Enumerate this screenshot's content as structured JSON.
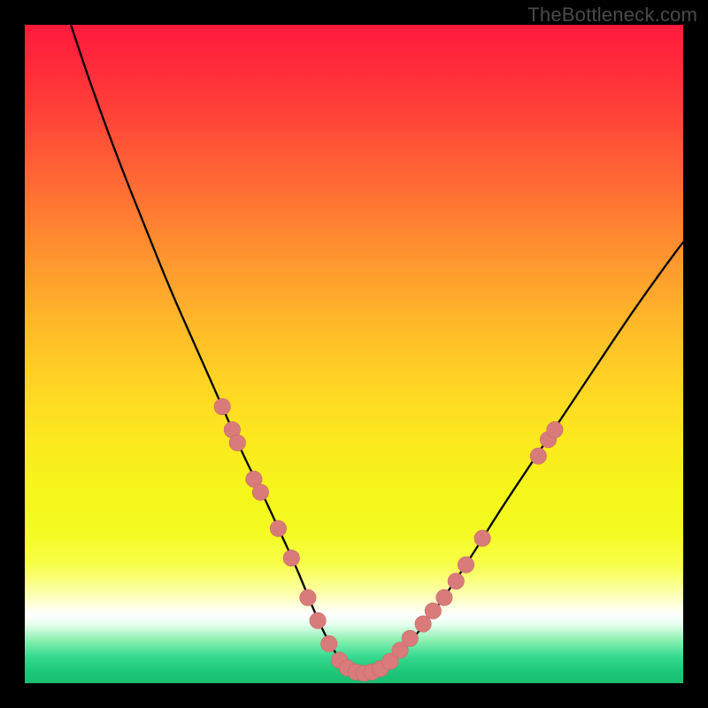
{
  "watermark": "TheBottleneck.com",
  "colors": {
    "background": "#000000",
    "curve": "#000000",
    "dot_fill": "#d97b7b",
    "dot_stroke": "#c96868"
  },
  "chart_data": {
    "type": "line",
    "title": "",
    "xlabel": "",
    "ylabel": "",
    "xlim": [
      0,
      100
    ],
    "ylim": [
      0,
      100
    ],
    "series": [
      {
        "name": "curve",
        "x": [
          7,
          10,
          14,
          18,
          22,
          26,
          30,
          33,
          36,
          39,
          41.5,
          43.5,
          45.5,
          47.5,
          49.5,
          51.5,
          54,
          57,
          60,
          64,
          68,
          72,
          77,
          82,
          87,
          92,
          97,
          100
        ],
        "y": [
          100,
          91,
          80,
          70,
          60,
          51,
          42,
          35,
          29,
          22.5,
          17,
          12,
          7.5,
          4,
          2,
          1.5,
          2,
          4.5,
          8,
          13.5,
          19.5,
          26,
          33.5,
          41,
          48.5,
          56,
          63,
          67
        ]
      }
    ],
    "markers": [
      {
        "x": 30.0,
        "y": 42.0
      },
      {
        "x": 31.5,
        "y": 38.5
      },
      {
        "x": 32.3,
        "y": 36.5
      },
      {
        "x": 34.8,
        "y": 31.0
      },
      {
        "x": 35.8,
        "y": 29.0
      },
      {
        "x": 38.5,
        "y": 23.5
      },
      {
        "x": 40.5,
        "y": 19.0
      },
      {
        "x": 43.0,
        "y": 13.0
      },
      {
        "x": 44.5,
        "y": 9.5
      },
      {
        "x": 46.2,
        "y": 6.0
      },
      {
        "x": 47.8,
        "y": 3.5
      },
      {
        "x": 49.0,
        "y": 2.3
      },
      {
        "x": 50.3,
        "y": 1.7
      },
      {
        "x": 51.5,
        "y": 1.5
      },
      {
        "x": 52.7,
        "y": 1.7
      },
      {
        "x": 54.0,
        "y": 2.2
      },
      {
        "x": 55.5,
        "y": 3.3
      },
      {
        "x": 57.0,
        "y": 5.0
      },
      {
        "x": 58.5,
        "y": 6.8
      },
      {
        "x": 60.5,
        "y": 9.0
      },
      {
        "x": 62.0,
        "y": 11.0
      },
      {
        "x": 63.7,
        "y": 13.0
      },
      {
        "x": 65.5,
        "y": 15.5
      },
      {
        "x": 67.0,
        "y": 18.0
      },
      {
        "x": 69.5,
        "y": 22.0
      },
      {
        "x": 78.0,
        "y": 34.5
      },
      {
        "x": 79.5,
        "y": 37.0
      },
      {
        "x": 80.5,
        "y": 38.5
      }
    ]
  }
}
